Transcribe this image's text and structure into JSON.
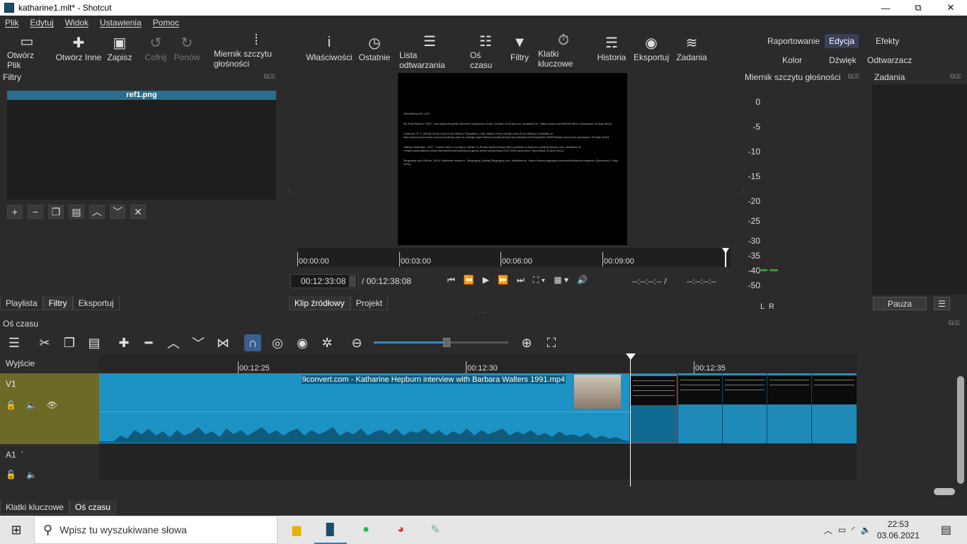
{
  "window": {
    "title": "katharine1.mlt* - Shotcut",
    "controls": [
      "—",
      "⧉",
      "✕"
    ]
  },
  "menu": [
    "Plik",
    "Edytuj",
    "Widok",
    "Ustawienia",
    "Pomoc"
  ],
  "toolbar": {
    "items": [
      {
        "label": "Otwórz Plik",
        "icon": "folder-open-icon"
      },
      {
        "label": "Otwórz Inne",
        "icon": "open-other-icon"
      },
      {
        "label": "Zapisz",
        "icon": "save-icon"
      },
      {
        "label": "Cofnij",
        "icon": "undo-icon"
      },
      {
        "label": "Ponów",
        "icon": "redo-icon"
      },
      {
        "label": "Miernik szczytu głośności",
        "icon": "peak-meter-icon"
      },
      {
        "label": "Właściwości",
        "icon": "info-icon"
      },
      {
        "label": "Ostatnie",
        "icon": "clock-icon"
      },
      {
        "label": "Lista odtwarzania",
        "icon": "playlist-icon"
      },
      {
        "label": "Oś czasu",
        "icon": "timeline-icon"
      },
      {
        "label": "Filtry",
        "icon": "filter-icon"
      },
      {
        "label": "Klatki kluczowe",
        "icon": "stopwatch-icon"
      },
      {
        "label": "Historia",
        "icon": "history-icon"
      },
      {
        "label": "Eksportuj",
        "icon": "export-icon"
      },
      {
        "label": "Zadania",
        "icon": "jobs-icon"
      }
    ],
    "layouts": {
      "raportowanie": "Raportowanie",
      "edycja": "Edycja",
      "efekty": "Efekty",
      "kolor": "Kolor",
      "dzwiek": "Dźwięk",
      "odtwarzacz": "Odtwarzacz"
    }
  },
  "filters": {
    "title": "Filtry",
    "selected_item": "ref1.png",
    "tabs": [
      "Playlista",
      "Filtry",
      "Eksportuj"
    ]
  },
  "preview": {
    "doc_lines": [
      "REFERENCES LIST:",
      "Be Kind Rewind, 2020. How Ingrid Bergman Became Hollywood's Exile. [online] YouTube.com. Available at: <https://youtu.be/m522WY8o1I> [Accessed 24 May 2021].",
      "Coleman, R. F. (2008) Great Lives From History. Pasadena, Calif: Salem Press (Great Lives From History). Available at: http://search.ebscohost.com.proxy.library.dmu.ac.uk/login.aspx?direct=true&AuthType=ip,shib&db=e000xww&AN=253523&site=ehost-live [Accessed: 20 May 2021].",
      "Jeffrey Fleishman, 2017. 'Guess Who's Coming to Dinner' is 50 and racial tension still a problem in America. [online] latimes.com. Available at: <https://www.latimes.com/entertainment/movies/la-ca-guess-dinner-anniversary-20170531-story.html> [Accessed 22 April 2021].",
      "Biography.com Editors, 2014. Katharine Hepburn - Biography. [online] Biography.com. Available at: <https://www.biography.com/actor/katharine-hepburn> [Accessed 1 May 2021]."
    ],
    "ruler_ticks": [
      "00:00:00",
      "00:03:00",
      "00:06:00",
      "00:09:00"
    ],
    "current_time": "00:12:33:08",
    "total_time": "/ 00:12:38:08",
    "in_point": "--:--:--:-- /",
    "out_point": "--:--:--:--",
    "tabs": [
      "Klip źródłowy",
      "Projekt"
    ]
  },
  "meter": {
    "title": "Miernik szczytu głośności",
    "scale": [
      "0",
      "-5",
      "-10",
      "-15",
      "-20",
      "-25",
      "-30",
      "-35",
      "-40",
      "-50"
    ],
    "channels": "L  R",
    "level_db": -40,
    "level_color": "#2fa02f"
  },
  "jobs": {
    "title": "Zadania",
    "pause": "Pauza",
    "menu": "☰"
  },
  "timeline": {
    "title": "Oś czasu",
    "tracks": {
      "output": "Wyjście",
      "v1": "V1",
      "a1": "A1  `"
    },
    "ruler_ticks": [
      "00:12:25",
      "00:12:30",
      "00:12:35"
    ],
    "clip_label": "9convert.com - Katharine Hepburn interview with Barbara Walters 1991.mp4",
    "bottom_tabs": [
      "Klatki kluczowe",
      "Oś czasu"
    ],
    "zoom_fraction": 0.55
  },
  "taskbar": {
    "search_placeholder": "Wpisz tu wyszukiwane słowa",
    "time": "22:53",
    "date": "03.06.2021"
  }
}
